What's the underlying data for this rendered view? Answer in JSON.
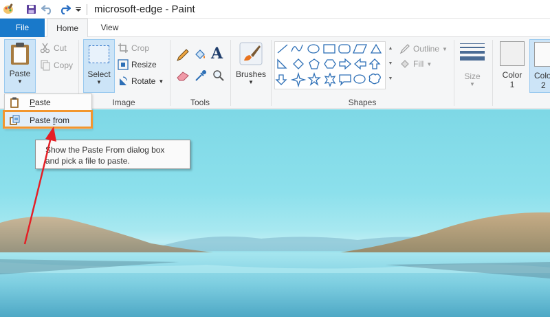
{
  "window": {
    "title": "microsoft-edge - Paint"
  },
  "quick_access": {
    "icons": [
      "paint-app-icon",
      "save-icon",
      "undo-icon",
      "redo-icon",
      "customize-toolbar-icon"
    ]
  },
  "tabs": {
    "file": "File",
    "home": "Home",
    "view": "View"
  },
  "ribbon": {
    "clipboard": {
      "paste": "Paste",
      "cut": "Cut",
      "copy": "Copy"
    },
    "image": {
      "label": "Image",
      "select": "Select",
      "crop": "Crop",
      "resize": "Resize",
      "rotate": "Rotate"
    },
    "tools": {
      "label": "Tools"
    },
    "brushes": {
      "label": "Brushes"
    },
    "shapes": {
      "label": "Shapes",
      "outline": "Outline",
      "fill": "Fill"
    },
    "size": {
      "label": "Size"
    },
    "colors": {
      "color1": "Color",
      "color1_num": "1",
      "color2": "Colo",
      "color2_num": "2"
    }
  },
  "paste_menu": {
    "paste_prefix": "",
    "paste_key": "P",
    "paste_rest": "aste",
    "paste_from_prefix": "Paste ",
    "paste_from_key": "f",
    "paste_from_rest": "rom"
  },
  "tooltip": {
    "line1": "Show the Paste From dialog box",
    "line2": "and pick a file to paste."
  },
  "colors": {
    "file_tab": "#1979ca",
    "highlight": "#f2962e",
    "arrow": "#e41f26",
    "selected_button": "#cce4f7"
  }
}
